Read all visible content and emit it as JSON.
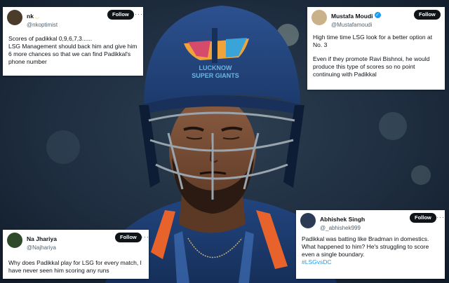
{
  "tweets": {
    "nk": {
      "name": "nk",
      "handle": "@nkoptimist",
      "follow_label": "Follow",
      "more_label": "···",
      "line1": "Scores of padikkal 0,9,6,7,3......",
      "line2": "LSG Management should back him and  give him 6 more chances so that we can find Padikkal's phone number"
    },
    "mustafa": {
      "name": "Mustafa Moudi",
      "handle": "@Mustafamoudi",
      "follow_label": "Follow",
      "more_label": "···",
      "line1": "High time time LSG look for a better option at No. 3",
      "line2": "Even if they promote Ravi Bishnoi, he would produce this type of scores so no point continuing with Padikkal"
    },
    "na": {
      "name": "Na Jhariya",
      "handle": "@Najhariya",
      "follow_label": "Follow",
      "more_label": "···",
      "line1": "Why does Padikkal play for LSG for every match, I have never seen him scoring any runs"
    },
    "abhishek": {
      "name": "Abhishek Singh",
      "handle": "@_abhishek999",
      "follow_label": "Follow",
      "more_label": "···",
      "line1": "Padikkal was batting like Bradman in domestics. What happened to him? He's struggling to score even a single boundary.",
      "hashtag": "#LSGvsDC"
    }
  },
  "helmet": {
    "logo_line1": "LUCKNOW",
    "logo_line2": "SUPER GIANTS"
  },
  "colors": {
    "helmet_blue": "#274a86",
    "jersey_navy": "#1d3c72",
    "jersey_orange": "#e8632b",
    "follow_bg": "#0f1419",
    "link_blue": "#1d9bf0"
  }
}
